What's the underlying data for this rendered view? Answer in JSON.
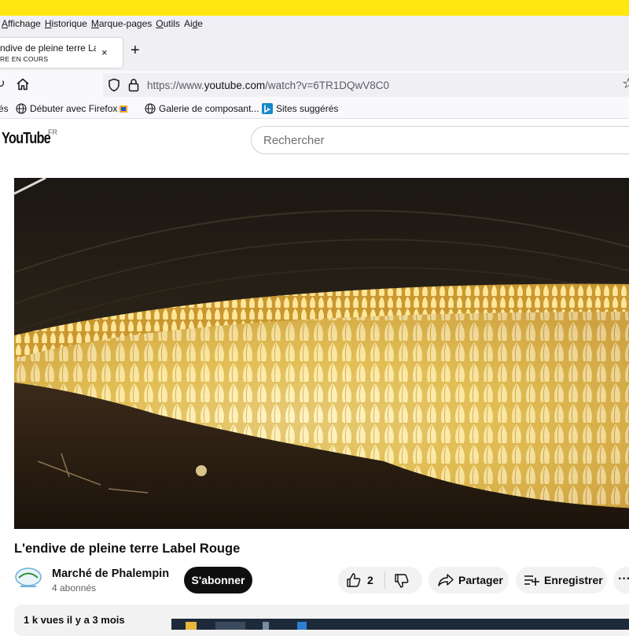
{
  "menu": {
    "items": [
      {
        "pre": "",
        "u": "A",
        "post": "ffichage"
      },
      {
        "pre": "",
        "u": "H",
        "post": "istorique"
      },
      {
        "pre": "",
        "u": "M",
        "post": "arque-pages"
      },
      {
        "pre": "",
        "u": "O",
        "post": "utils"
      },
      {
        "pre": "Ai",
        "u": "d",
        "post": "e"
      }
    ]
  },
  "tab": {
    "title": "ndive de pleine terre Label Rouge",
    "status": "RE EN COURS",
    "close_icon": "×",
    "new_tab_icon": "+"
  },
  "navbar": {
    "url_prefix": "https://www.",
    "url_domain": "youtube.com",
    "url_path": "/watch?v=6TR1DQwV8C0"
  },
  "bookmarks": {
    "partial": "és",
    "items": [
      {
        "label": "Débuter avec Firefox"
      },
      {
        "label": "Galerie de composant..."
      },
      {
        "label": "Sites suggérés"
      }
    ]
  },
  "youtube": {
    "logo": "YouTube",
    "region": "FR",
    "search_placeholder": "Rechercher"
  },
  "video": {
    "title": "L'endive de pleine terre Label Rouge",
    "channel": "Marché de Phalempin",
    "subscribers": "4 abonnés",
    "subscribe_label": "S'abonner",
    "likes": "2",
    "share_label": "Partager",
    "save_label": "Enregistrer",
    "more_label": "···",
    "description_meta": "1 k vues  il y a 3 mois"
  },
  "colors": {
    "firefox_accent": "#ffe70f",
    "subscribe_bg": "#0f0f0f",
    "pill_bg": "#f2f2f2"
  }
}
